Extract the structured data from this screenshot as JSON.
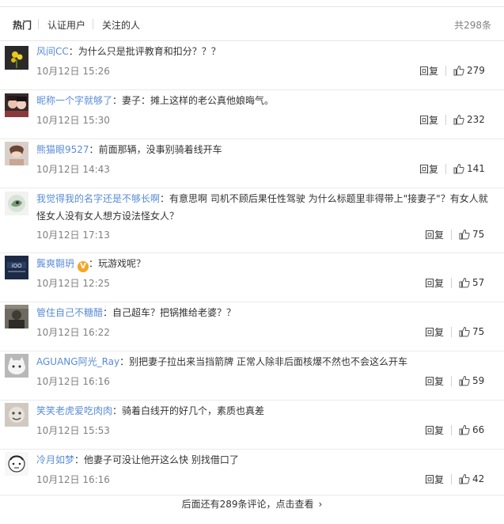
{
  "tabs": [
    {
      "label": "热门"
    },
    {
      "label": "认证用户"
    },
    {
      "label": "关注的人"
    }
  ],
  "total": "共298条",
  "reply_label": "回复",
  "comments": [
    {
      "user": "风间CC",
      "text": "为什么只是批评教育和扣分？？？",
      "time": "10月12日 15:26",
      "likes": "279"
    },
    {
      "user": "昵称一个字就够了",
      "text": "妻子：摊上这样的老公真他娘晦气。",
      "time": "10月12日 15:30",
      "likes": "232"
    },
    {
      "user": "熊猫眼9527",
      "text": "前面那辆，没事别骑着线开车",
      "time": "10月12日 14:43",
      "likes": "141"
    },
    {
      "user": "我觉得我的名字还是不够长啊",
      "text": "有意思啊 司机不顾后果任性驾驶 为什么标题里非得带上\"接妻子\"？有女人就怪女人没有女人想方设法怪女人？",
      "time": "10月12日 17:13",
      "likes": "75"
    },
    {
      "user": "龔爽翾玬",
      "text": "玩游戏呢？",
      "time": "10月12日 12:25",
      "likes": "57",
      "badge": "V"
    },
    {
      "user": "管住自己不糖醋",
      "text": "自己超车？把锅推给老婆？？",
      "time": "10月12日 16:22",
      "likes": "75"
    },
    {
      "user": "AGUANG阿光_Ray",
      "text": "别把妻子拉出来当挡箭牌 正常人除非后面核爆不然也不会这么开车",
      "time": "10月12日 16:16",
      "likes": "59"
    },
    {
      "user": "笑笑老虎爱吃肉肉",
      "text": "骑着白线开的好几个，素质也真差",
      "time": "10月12日 15:53",
      "likes": "66"
    },
    {
      "user": "冷月如梦",
      "text": "他妻子可没让他开这么快 别找借口了",
      "time": "10月12日 16:16",
      "likes": "42"
    }
  ],
  "more_text": "后面还有289条评论，点击查看",
  "colors": {
    "username": "#5a8cd6",
    "muted": "#808080",
    "divider": "#eaeaea"
  }
}
